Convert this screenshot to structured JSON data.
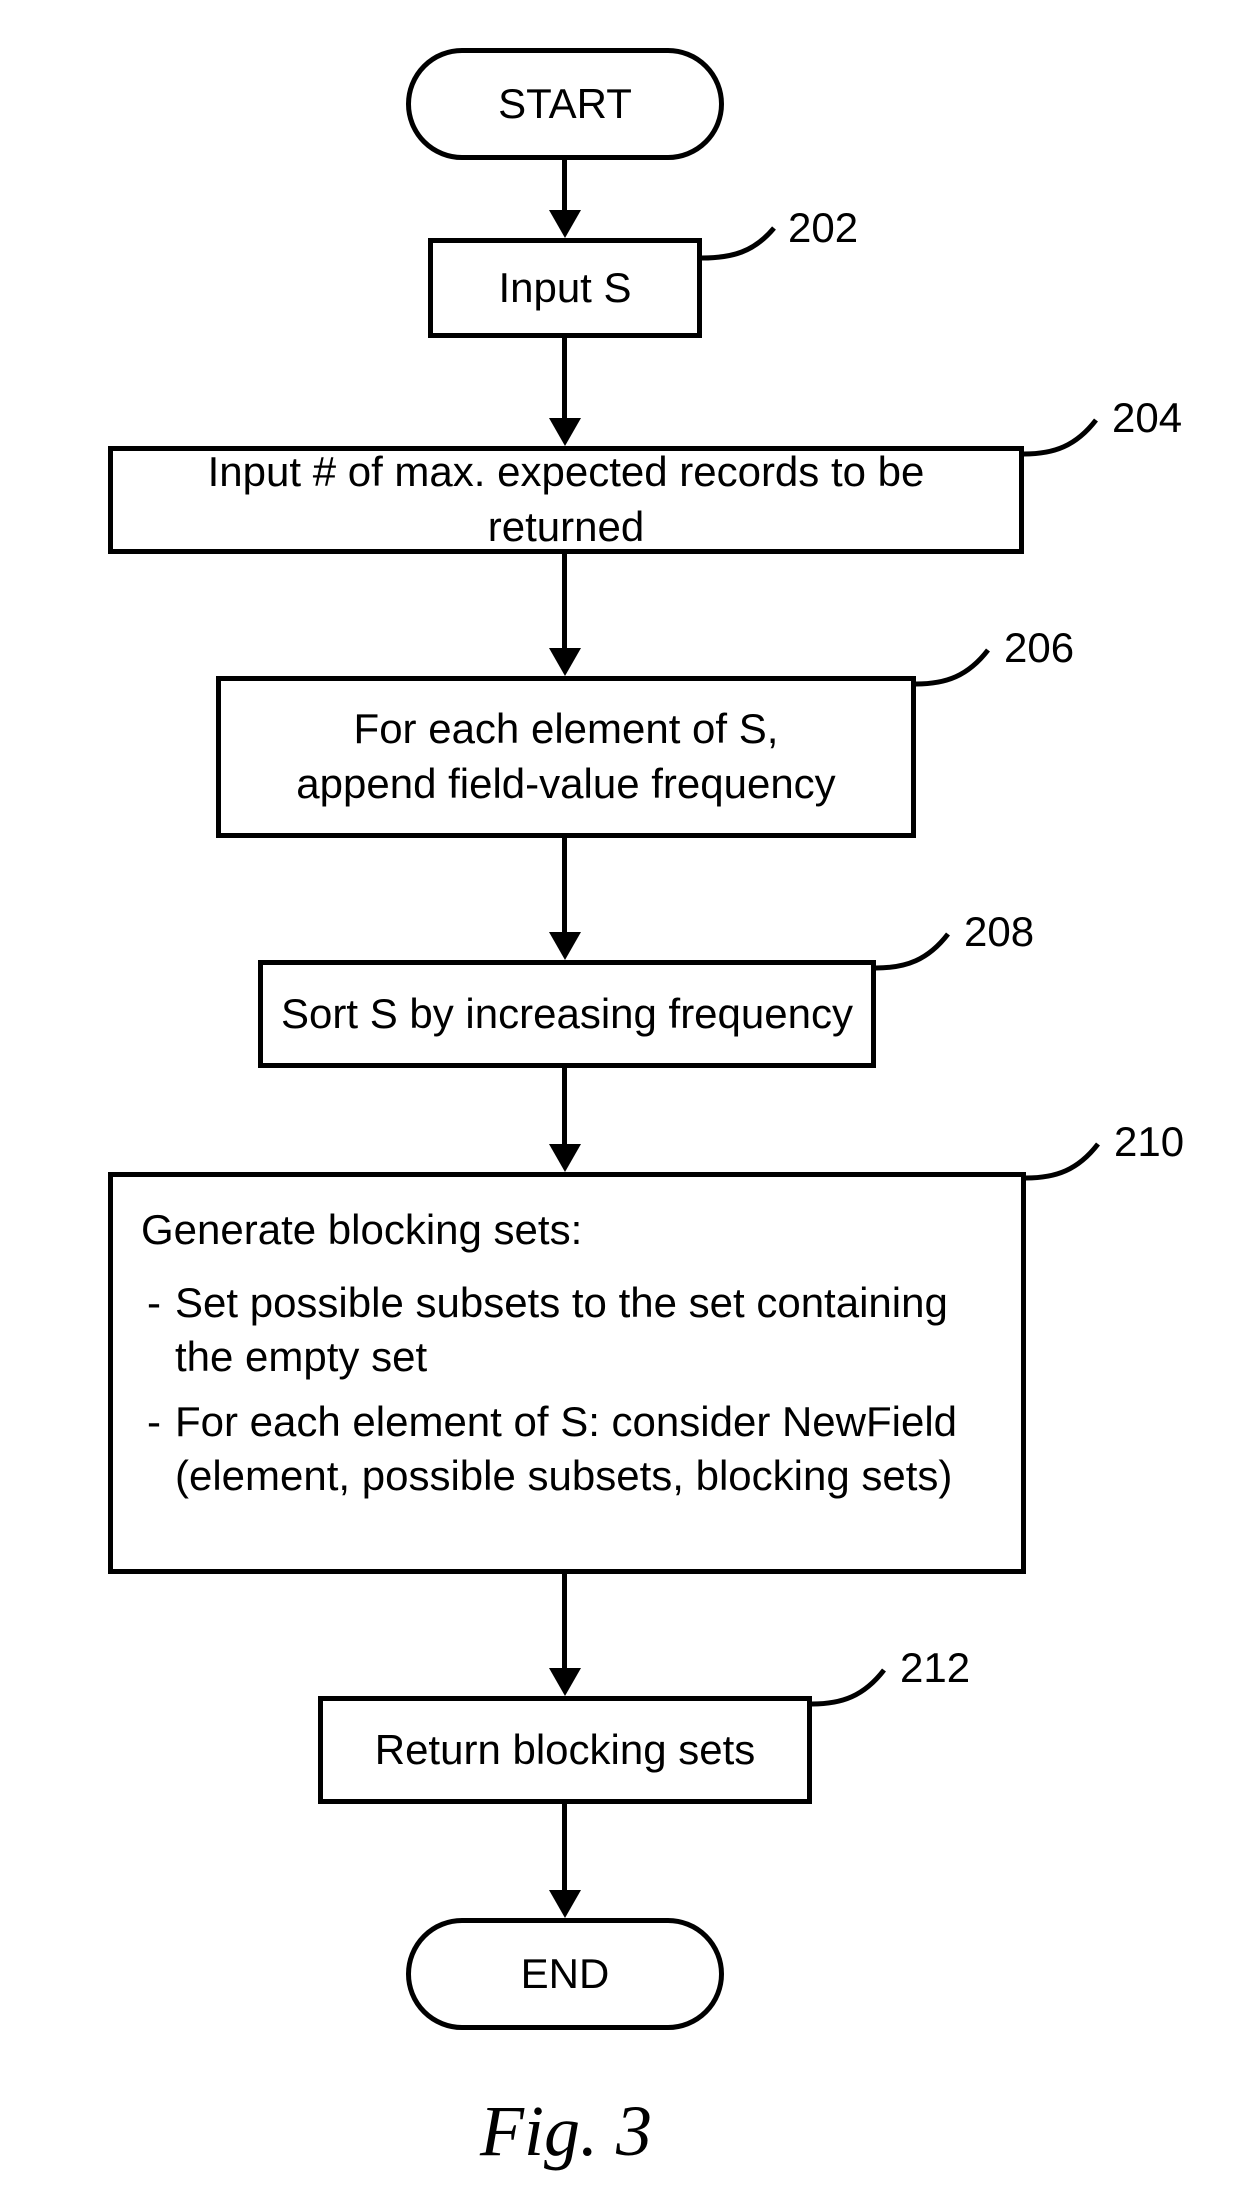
{
  "flowchart": {
    "start": "START",
    "end": "END",
    "steps": {
      "s202": {
        "ref": "202",
        "text": "Input S"
      },
      "s204": {
        "ref": "204",
        "text": "Input # of max. expected records to be returned"
      },
      "s206": {
        "ref": "206",
        "text": "For each element of S,\nappend field-value frequency"
      },
      "s208": {
        "ref": "208",
        "text": "Sort S by increasing frequency"
      },
      "s210": {
        "ref": "210",
        "heading": "Generate blocking sets:",
        "bullets": [
          "Set possible subsets to the set containing the empty set",
          "For each element of S: consider NewField (element, possible subsets, blocking sets)"
        ]
      },
      "s212": {
        "ref": "212",
        "text": "Return blocking sets"
      }
    }
  },
  "caption": "Fig. 3"
}
